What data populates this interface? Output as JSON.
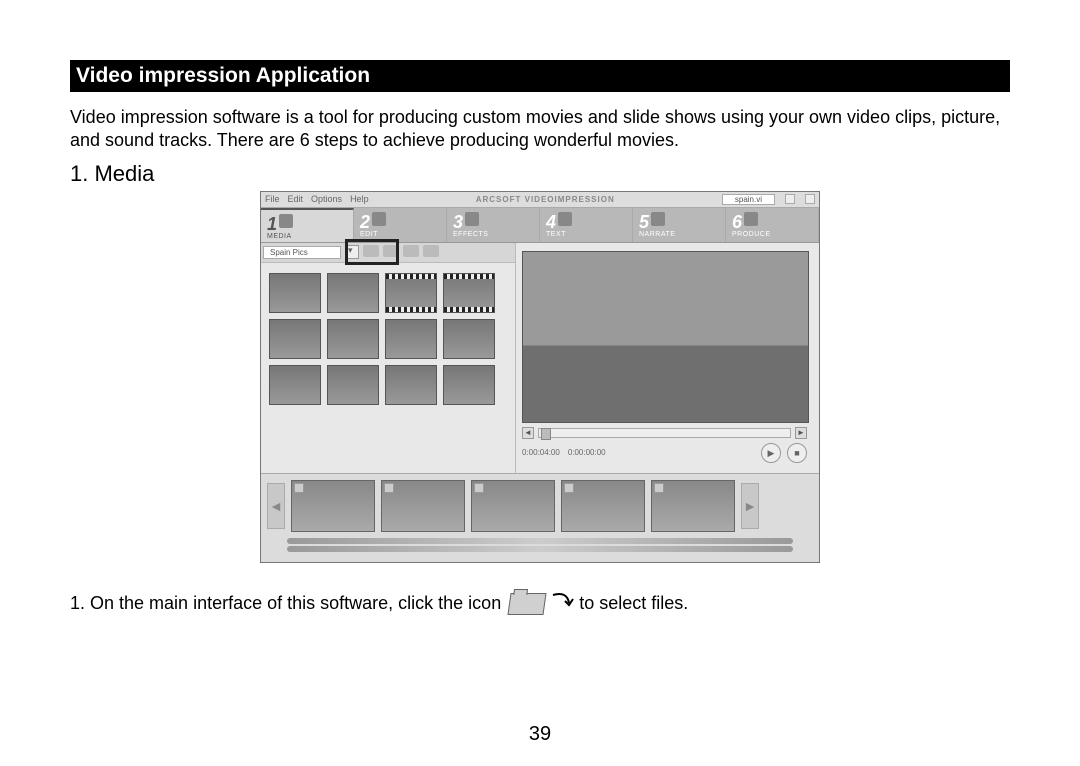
{
  "section_title": "Video impression Application",
  "intro": "Video impression software is a tool for producing custom movies and slide shows using your own video clips, picture, and sound tracks. There are 6 steps to achieve producing wonderful movies.",
  "step_heading": "1. Media",
  "menubar": {
    "items": [
      "File",
      "Edit",
      "Options",
      "Help"
    ],
    "brand": "ARCSOFT VIDEOIMPRESSION",
    "filename": "spain.vi"
  },
  "tabs": [
    {
      "num": "1",
      "label": "MEDIA"
    },
    {
      "num": "2",
      "label": "EDIT"
    },
    {
      "num": "3",
      "label": "EFFECTS"
    },
    {
      "num": "4",
      "label": "TEXT"
    },
    {
      "num": "5",
      "label": "NARRATE"
    },
    {
      "num": "6",
      "label": "PRODUCE"
    }
  ],
  "album_name": "Spain Pics",
  "timecode": {
    "a": "0:00:04:00",
    "b": "0:00:00:00"
  },
  "instruction": {
    "pre": "1. On the main interface of this software, click the icon",
    "post": "to select files."
  },
  "page_number": "39"
}
